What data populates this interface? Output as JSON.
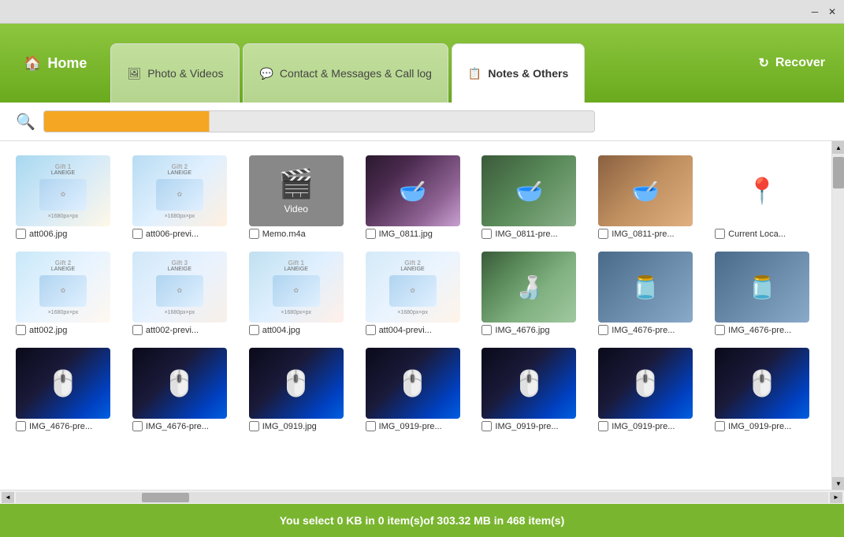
{
  "titlebar": {
    "minimize_label": "─",
    "close_label": "✕"
  },
  "header": {
    "home_label": "Home",
    "tabs": [
      {
        "id": "photo",
        "label": "Photo & Videos",
        "icon": "🖼"
      },
      {
        "id": "contact",
        "label": "Contact & Messages & Call log",
        "icon": "💬"
      },
      {
        "id": "notes",
        "label": "Notes & Others",
        "icon": "📋"
      }
    ],
    "recover_label": "Recover"
  },
  "search": {
    "placeholder": ""
  },
  "files": [
    {
      "name": "att006.jpg",
      "thumb": "laneige1"
    },
    {
      "name": "att006-previ...",
      "thumb": "laneige2"
    },
    {
      "name": "Memo.m4a",
      "thumb": "video"
    },
    {
      "name": "IMG_0811.jpg",
      "thumb": "bowls1"
    },
    {
      "name": "IMG_0811-pre...",
      "thumb": "bowls2"
    },
    {
      "name": "IMG_0811-pre...",
      "thumb": "bowls3"
    },
    {
      "name": "Current Loca...",
      "thumb": "pin"
    },
    {
      "name": "att002.jpg",
      "thumb": "laneige3"
    },
    {
      "name": "att002-previ...",
      "thumb": "laneige4"
    },
    {
      "name": "att004.jpg",
      "thumb": "laneige5"
    },
    {
      "name": "att004-previ...",
      "thumb": "laneige6"
    },
    {
      "name": "IMG_4676.jpg",
      "thumb": "bottles"
    },
    {
      "name": "IMG_4676-pre...",
      "thumb": "cups"
    },
    {
      "name": "IMG_4676-pre...",
      "thumb": "cups"
    },
    {
      "name": "IMG_4676-pre...",
      "thumb": "mouse1"
    },
    {
      "name": "IMG_4676-pre...",
      "thumb": "mouse2"
    },
    {
      "name": "IMG_0919.jpg",
      "thumb": "mouse1"
    },
    {
      "name": "IMG_0919-pre...",
      "thumb": "mouse2"
    },
    {
      "name": "IMG_0919-pre...",
      "thumb": "mouse3"
    },
    {
      "name": "IMG_0919-pre...",
      "thumb": "mouse1"
    },
    {
      "name": "IMG_0919-pre...",
      "thumb": "mouse2"
    }
  ],
  "status": {
    "text": "You select 0 KB in 0 item(s)of 303.32 MB in 468 item(s)"
  }
}
